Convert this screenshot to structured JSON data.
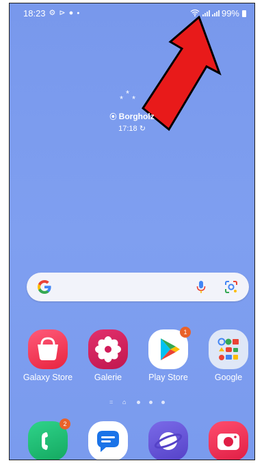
{
  "status_bar": {
    "time": "18:23",
    "battery": "99%"
  },
  "weather": {
    "location": "Borgholz",
    "time": "17:18"
  },
  "search": {
    "icons": [
      "google-g-icon",
      "microphone-icon",
      "google-lens-icon"
    ]
  },
  "apps": [
    {
      "label": "Galaxy Store"
    },
    {
      "label": "Galerie"
    },
    {
      "label": "Play Store",
      "badge": "1"
    },
    {
      "label": "Google"
    }
  ],
  "dock": [
    {
      "app": "phone",
      "badge": "2"
    },
    {
      "app": "messages"
    },
    {
      "app": "internet"
    },
    {
      "app": "camera"
    }
  ],
  "colors": {
    "wallpaper": "#7a9bee",
    "arrow": "#e81a1a",
    "badge": "#e9622a"
  }
}
